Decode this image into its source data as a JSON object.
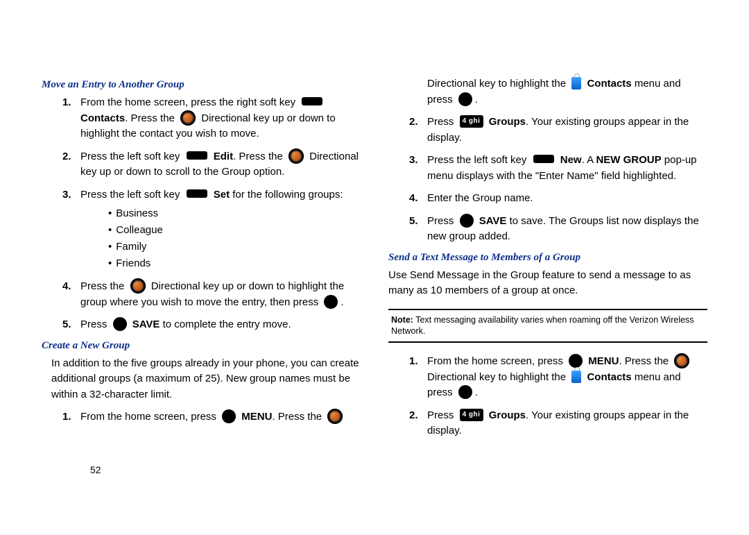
{
  "page_number": "52",
  "left": {
    "h1": "Move an Entry to Another Group",
    "steps1": [
      {
        "num": "1.",
        "pre": "From the home screen, press the right soft key",
        "post1": "Contacts",
        "post2": ". Press the",
        "post3": "Directional key up or down to highlight the contact you wish to move."
      },
      {
        "num": "2.",
        "pre": "Press the left soft key",
        "mid": "Edit",
        "post": ". Press the",
        "tail": "Directional key up or down to scroll to the Group option."
      },
      {
        "num": "3.",
        "pre": "Press the left soft key",
        "mid": "Set",
        "post": " for the following groups:"
      },
      {
        "num": "4.",
        "pre": "Press the",
        "post": "Directional key up or down to highlight the group where you wish to move the entry, then press",
        "tail": "."
      },
      {
        "num": "5.",
        "pre": "Press",
        "mid": "SAVE",
        "post": " to complete the entry move."
      }
    ],
    "bullets": [
      "Business",
      "Colleague",
      "Family",
      "Friends"
    ],
    "h2": "Create a New Group",
    "para": "In addition to the five groups already in your phone, you can create additional groups (a maximum of 25). New group names must be within a 32-character limit.",
    "steps2": [
      {
        "num": "1.",
        "pre": "From the home screen, press",
        "mid": "MENU",
        "post": ". Press the"
      }
    ]
  },
  "right": {
    "cont": {
      "pre": "Directional key to highlight the",
      "mid": "Contacts",
      "post": " menu and press",
      "tail": "."
    },
    "steps_a": [
      {
        "num": "2.",
        "pre": "Press",
        "key": "4 ghi",
        "mid": "Groups",
        "post": ". Your existing groups appear in the display."
      },
      {
        "num": "3.",
        "pre": "Press the left soft key",
        "mid": "New",
        "post": ". A ",
        "bold2": "NEW GROUP",
        "tail": " pop-up menu displays with the \"Enter Name\" field highlighted."
      },
      {
        "num": "4.",
        "text": "Enter the Group name."
      },
      {
        "num": "5.",
        "pre": "Press",
        "mid": "SAVE",
        "post": " to save. The Groups list now displays the new group added."
      }
    ],
    "h3": "Send a Text Message to Members of a Group",
    "para2": "Use Send Message in the Group feature to send a message to as many as 10 members of a group at once.",
    "note_label": "Note:",
    "note": "Text messaging availability varies when roaming off the Verizon Wireless Network.",
    "steps_b": [
      {
        "num": "1.",
        "pre": "From the home screen, press",
        "mid": "MENU",
        "post": ". Press the",
        "line2a": "Directional key to highlight the",
        "line2b": "Contacts",
        "line2c": " menu and press",
        "tail": "."
      },
      {
        "num": "2.",
        "pre": "Press",
        "key": "4 ghi",
        "mid": "Groups",
        "post": ". Your existing groups appear in the display."
      }
    ]
  }
}
